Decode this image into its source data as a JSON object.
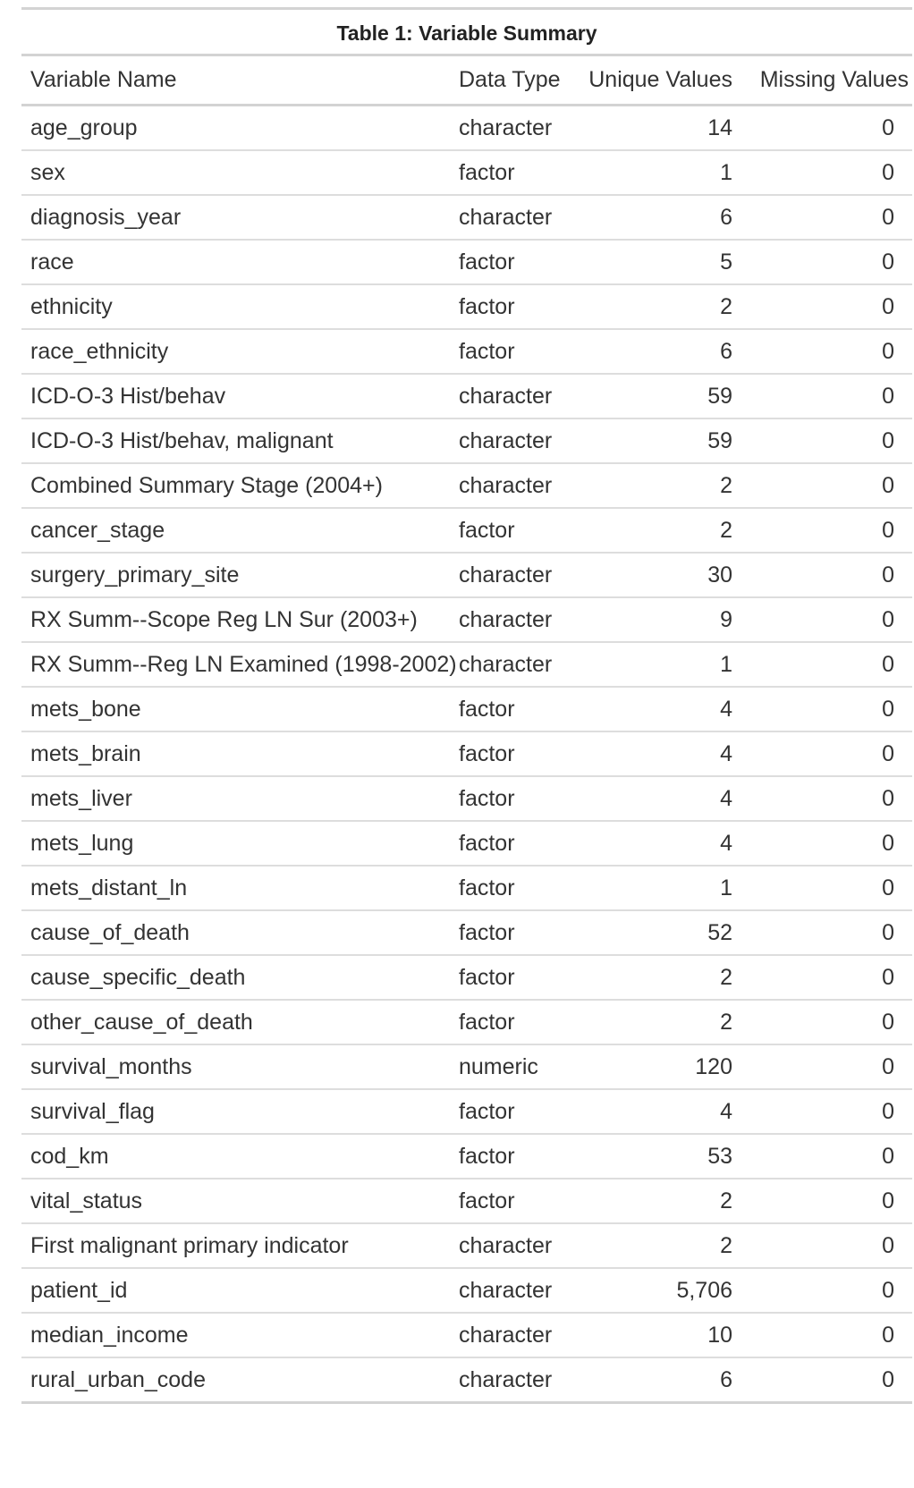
{
  "table": {
    "title": "Table 1: Variable Summary",
    "columns": [
      "Variable Name",
      "Data Type",
      "Unique Values",
      "Missing Values"
    ],
    "rows": [
      [
        "age_group",
        "character",
        "14",
        "0"
      ],
      [
        "sex",
        "factor",
        "1",
        "0"
      ],
      [
        "diagnosis_year",
        "character",
        "6",
        "0"
      ],
      [
        "race",
        "factor",
        "5",
        "0"
      ],
      [
        "ethnicity",
        "factor",
        "2",
        "0"
      ],
      [
        "race_ethnicity",
        "factor",
        "6",
        "0"
      ],
      [
        "ICD-O-3 Hist/behav",
        "character",
        "59",
        "0"
      ],
      [
        "ICD-O-3 Hist/behav, malignant",
        "character",
        "59",
        "0"
      ],
      [
        "Combined Summary Stage (2004+)",
        "character",
        "2",
        "0"
      ],
      [
        "cancer_stage",
        "factor",
        "2",
        "0"
      ],
      [
        "surgery_primary_site",
        "character",
        "30",
        "0"
      ],
      [
        "RX Summ--Scope Reg LN Sur (2003+)",
        "character",
        "9",
        "0"
      ],
      [
        "RX Summ--Reg LN Examined (1998-2002)",
        "character",
        "1",
        "0"
      ],
      [
        "mets_bone",
        "factor",
        "4",
        "0"
      ],
      [
        "mets_brain",
        "factor",
        "4",
        "0"
      ],
      [
        "mets_liver",
        "factor",
        "4",
        "0"
      ],
      [
        "mets_lung",
        "factor",
        "4",
        "0"
      ],
      [
        "mets_distant_ln",
        "factor",
        "1",
        "0"
      ],
      [
        "cause_of_death",
        "factor",
        "52",
        "0"
      ],
      [
        "cause_specific_death",
        "factor",
        "2",
        "0"
      ],
      [
        "other_cause_of_death",
        "factor",
        "2",
        "0"
      ],
      [
        "survival_months",
        "numeric",
        "120",
        "0"
      ],
      [
        "survival_flag",
        "factor",
        "4",
        "0"
      ],
      [
        "cod_km",
        "factor",
        "53",
        "0"
      ],
      [
        "vital_status",
        "factor",
        "2",
        "0"
      ],
      [
        "First malignant primary indicator",
        "character",
        "2",
        "0"
      ],
      [
        "patient_id",
        "character",
        "5,706",
        "0"
      ],
      [
        "median_income",
        "character",
        "10",
        "0"
      ],
      [
        "rural_urban_code",
        "character",
        "6",
        "0"
      ]
    ]
  }
}
